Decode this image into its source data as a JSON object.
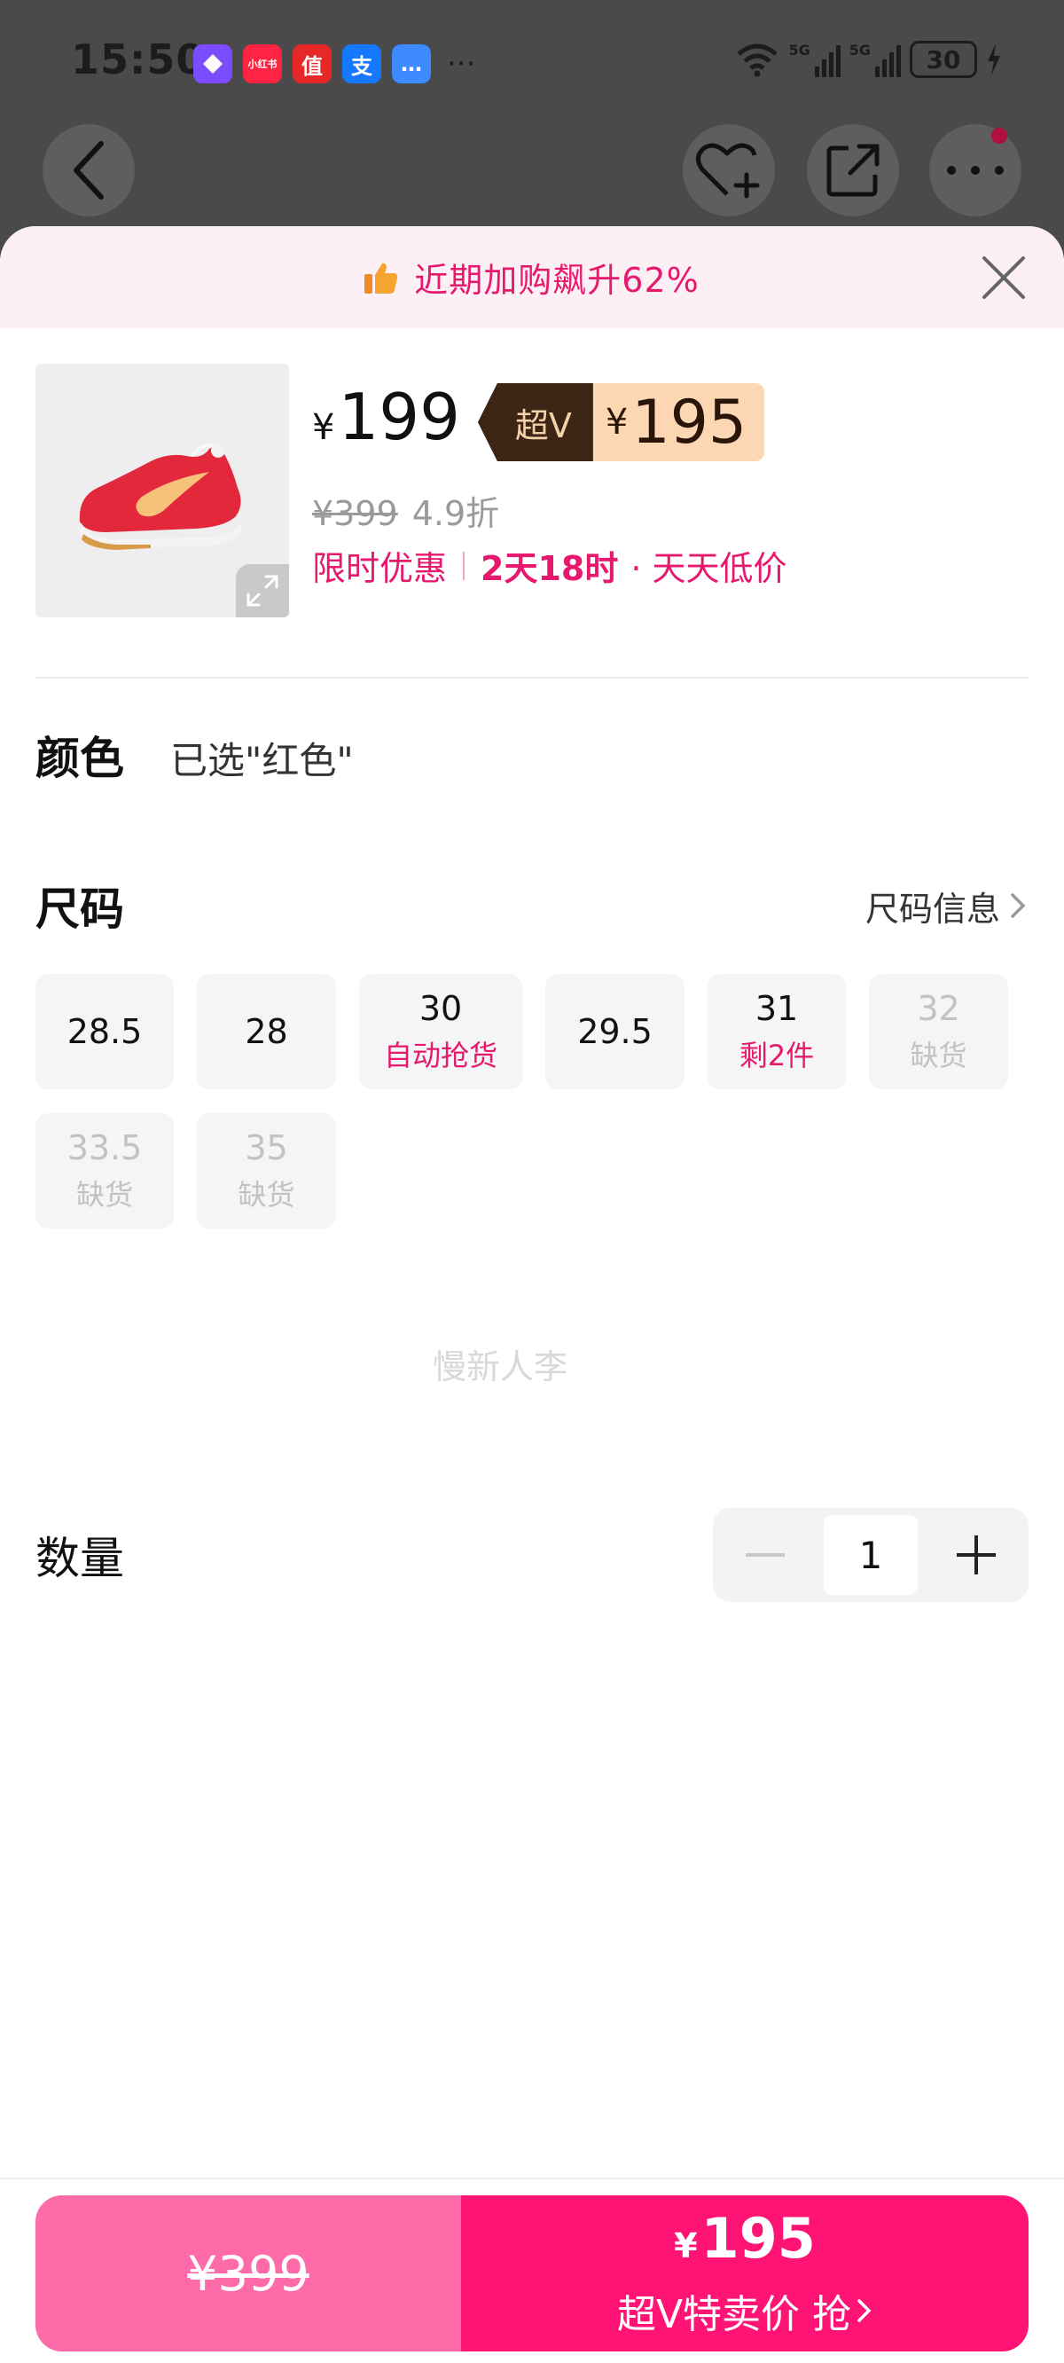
{
  "status_bar": {
    "time": "15:50",
    "app_icons": [
      {
        "icon": "diamond-app-icon",
        "label": "",
        "color": "#7c4dff"
      },
      {
        "icon": "xiaohongshu-icon",
        "label": "小红书",
        "color": "#ff2442"
      },
      {
        "icon": "smzdm-icon",
        "label": "值",
        "color": "#e62828"
      },
      {
        "icon": "alipay-icon",
        "label": "支",
        "color": "#1677ff"
      },
      {
        "icon": "message-icon",
        "label": "…",
        "color": "#3d8bff"
      }
    ],
    "more_apps": "···",
    "network_1": "5G",
    "network_2": "5G",
    "battery": "30"
  },
  "header": {
    "back_icon": "chevron-left-icon",
    "favorite_icon": "heart-plus-icon",
    "share_icon": "share-icon",
    "more_icon": "more-dots-icon"
  },
  "banner": {
    "icon": "thumbs-up-icon",
    "text": "近期加购飙升62%",
    "close_icon": "close-icon"
  },
  "product": {
    "price_currency": "¥",
    "price": "199",
    "vip_label": "超V",
    "vip_currency": "¥",
    "vip_price": "195",
    "original_price": "¥399",
    "discount": "4.9折",
    "promo_label": "限时优惠",
    "promo_countdown": "2天18时",
    "promo_suffix": "· 天天低价"
  },
  "color_section": {
    "title": "颜色",
    "selected": "已选\"红色\""
  },
  "size_section": {
    "title": "尺码",
    "info_link": "尺码信息",
    "sizes": [
      {
        "size": "28.5",
        "note": "",
        "available": true
      },
      {
        "size": "28",
        "note": "",
        "available": true
      },
      {
        "size": "30",
        "note": "自动抢货",
        "available": true
      },
      {
        "size": "29.5",
        "note": "",
        "available": true
      },
      {
        "size": "31",
        "note": "剩2件",
        "available": true
      },
      {
        "size": "32",
        "note": "缺货",
        "available": false
      },
      {
        "size": "33.5",
        "note": "缺货",
        "available": false
      },
      {
        "size": "35",
        "note": "缺货",
        "available": false
      }
    ]
  },
  "watermark": "慢新人李",
  "quantity": {
    "title": "数量",
    "value": "1"
  },
  "bottom_bar": {
    "original_price": "¥399",
    "currency": "¥",
    "price": "195",
    "cta": "超V特卖价 抢"
  },
  "colors": {
    "accent": "#e6196e",
    "buy_primary": "#ff1475",
    "buy_secondary": "#ff6aa8",
    "vip_dark": "#3d2516",
    "vip_light": "#fdd7b3"
  }
}
